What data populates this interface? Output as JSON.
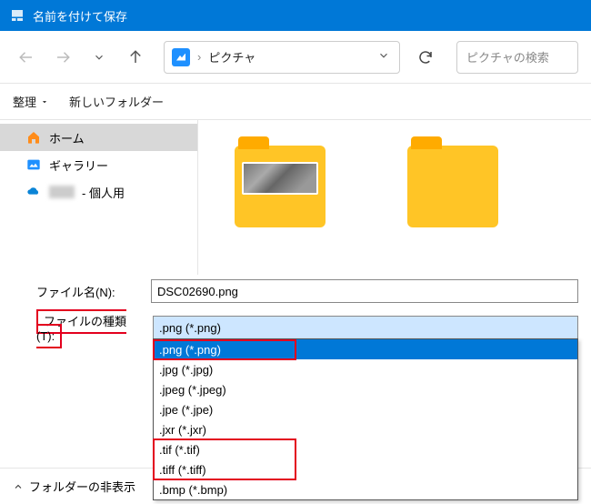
{
  "titlebar": {
    "title": "名前を付けて保存"
  },
  "nav": {
    "crumb": "ピクチャ"
  },
  "search": {
    "placeholder": "ピクチャの検索"
  },
  "toolbar": {
    "organize": "整理",
    "newfolder": "新しいフォルダー"
  },
  "sidebar": {
    "items": [
      {
        "label": "ホーム"
      },
      {
        "label": "ギャラリー"
      },
      {
        "label": " - 個人用"
      }
    ]
  },
  "form": {
    "filename_label": "ファイル名(N):",
    "filename_value": "DSC02690.png",
    "filetype_label": "ファイルの種類(T):",
    "filetype_selected": ".png (*.png)",
    "options": [
      ".png (*.png)",
      ".jpg (*.jpg)",
      ".jpeg (*.jpeg)",
      ".jpe (*.jpe)",
      ".jxr (*.jxr)",
      ".tif (*.tif)",
      ".tiff (*.tiff)",
      ".bmp (*.bmp)"
    ]
  },
  "bottom": {
    "hide_folders": "フォルダーの非表示"
  }
}
